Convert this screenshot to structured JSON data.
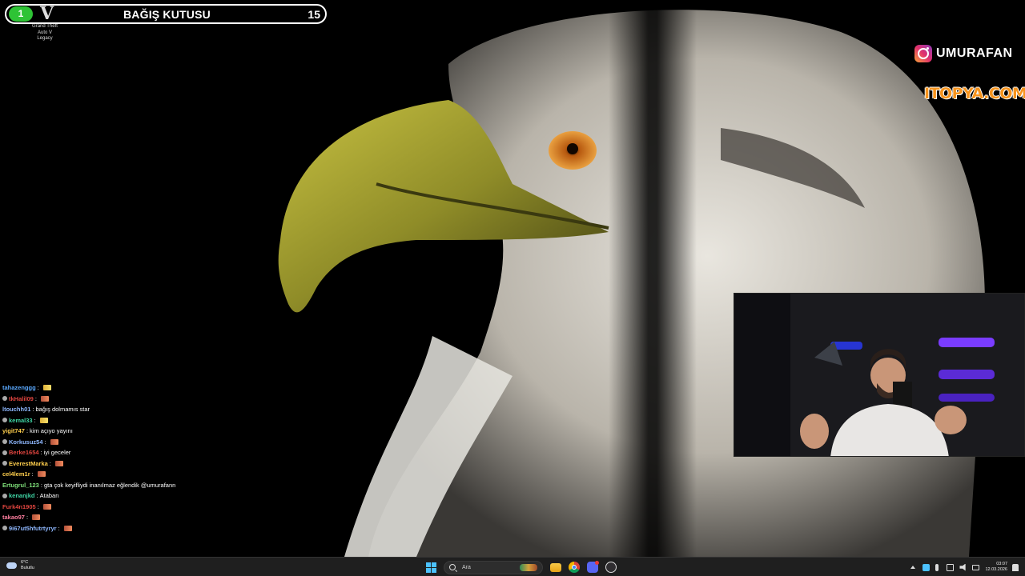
{
  "overlay": {
    "donation_badge": "1",
    "donation_title": "BAĞIŞ KUTUSU",
    "donation_count": "15",
    "game_caption": [
      "Grand Theft",
      "Auto V",
      "Legacy"
    ],
    "instagram_handle": "UMURAFAN",
    "sponsor": "ITOPYA.COM"
  },
  "chat": [
    {
      "user": "tahazenggg",
      "text": "",
      "user_color": "#5aa9ff",
      "icon": "gold",
      "badge": false
    },
    {
      "user": "tkHalil09",
      "text": "",
      "user_color": "#e0453f",
      "icon": "emote",
      "badge": true
    },
    {
      "user": "ltouchh01",
      "text": "bağış dolmamıs star",
      "user_color": "#8fb8ff",
      "icon": "",
      "badge": false
    },
    {
      "user": "kemal33",
      "text": "",
      "user_color": "#3fd4a4",
      "icon": "gold",
      "badge": true
    },
    {
      "user": "yigit747",
      "text": "kim açıyo yayını",
      "user_color": "#ffcf4d",
      "icon": "",
      "badge": false
    },
    {
      "user": "Korkusuz54",
      "text": "",
      "user_color": "#8fb8ff",
      "icon": "emote",
      "badge": true
    },
    {
      "user": "Berke1654",
      "text": "iyi geceler",
      "user_color": "#e0453f",
      "icon": "",
      "badge": true
    },
    {
      "user": "EverestMarka",
      "text": "",
      "user_color": "#ffcf4d",
      "icon": "emote",
      "badge": true
    },
    {
      "user": "cel4lem1r",
      "text": "",
      "user_color": "#ffcf4d",
      "icon": "emote",
      "badge": false
    },
    {
      "user": "Ertugrul_123",
      "text": "gta çok keyifliydi inanılmaz eğlendik @umurafann",
      "user_color": "#7fe07a",
      "icon": "",
      "badge": false
    },
    {
      "user": "kenanjkd",
      "text": "Atabarı",
      "user_color": "#3fd4a4",
      "icon": "",
      "badge": true
    },
    {
      "user": "Furk4n1905",
      "text": "",
      "user_color": "#e0453f",
      "icon": "emote",
      "badge": false
    },
    {
      "user": "takao97",
      "text": "",
      "user_color": "#ff7fa0",
      "icon": "emote",
      "badge": false
    },
    {
      "user": "9i67ut5hfutrtyryr",
      "text": "",
      "user_color": "#8fb8ff",
      "icon": "emote",
      "badge": true
    }
  ],
  "taskbar": {
    "weather_temp": "6°C",
    "weather_desc": "Bulutlu",
    "search_placeholder": "Ara",
    "time": "03:07",
    "date": "12.03.2026"
  },
  "icons": {
    "start": "windows-start-icon",
    "search": "search-icon",
    "folder": "file-explorer-icon",
    "chrome": "chrome-icon",
    "discord": "discord-icon",
    "obs": "obs-icon"
  }
}
